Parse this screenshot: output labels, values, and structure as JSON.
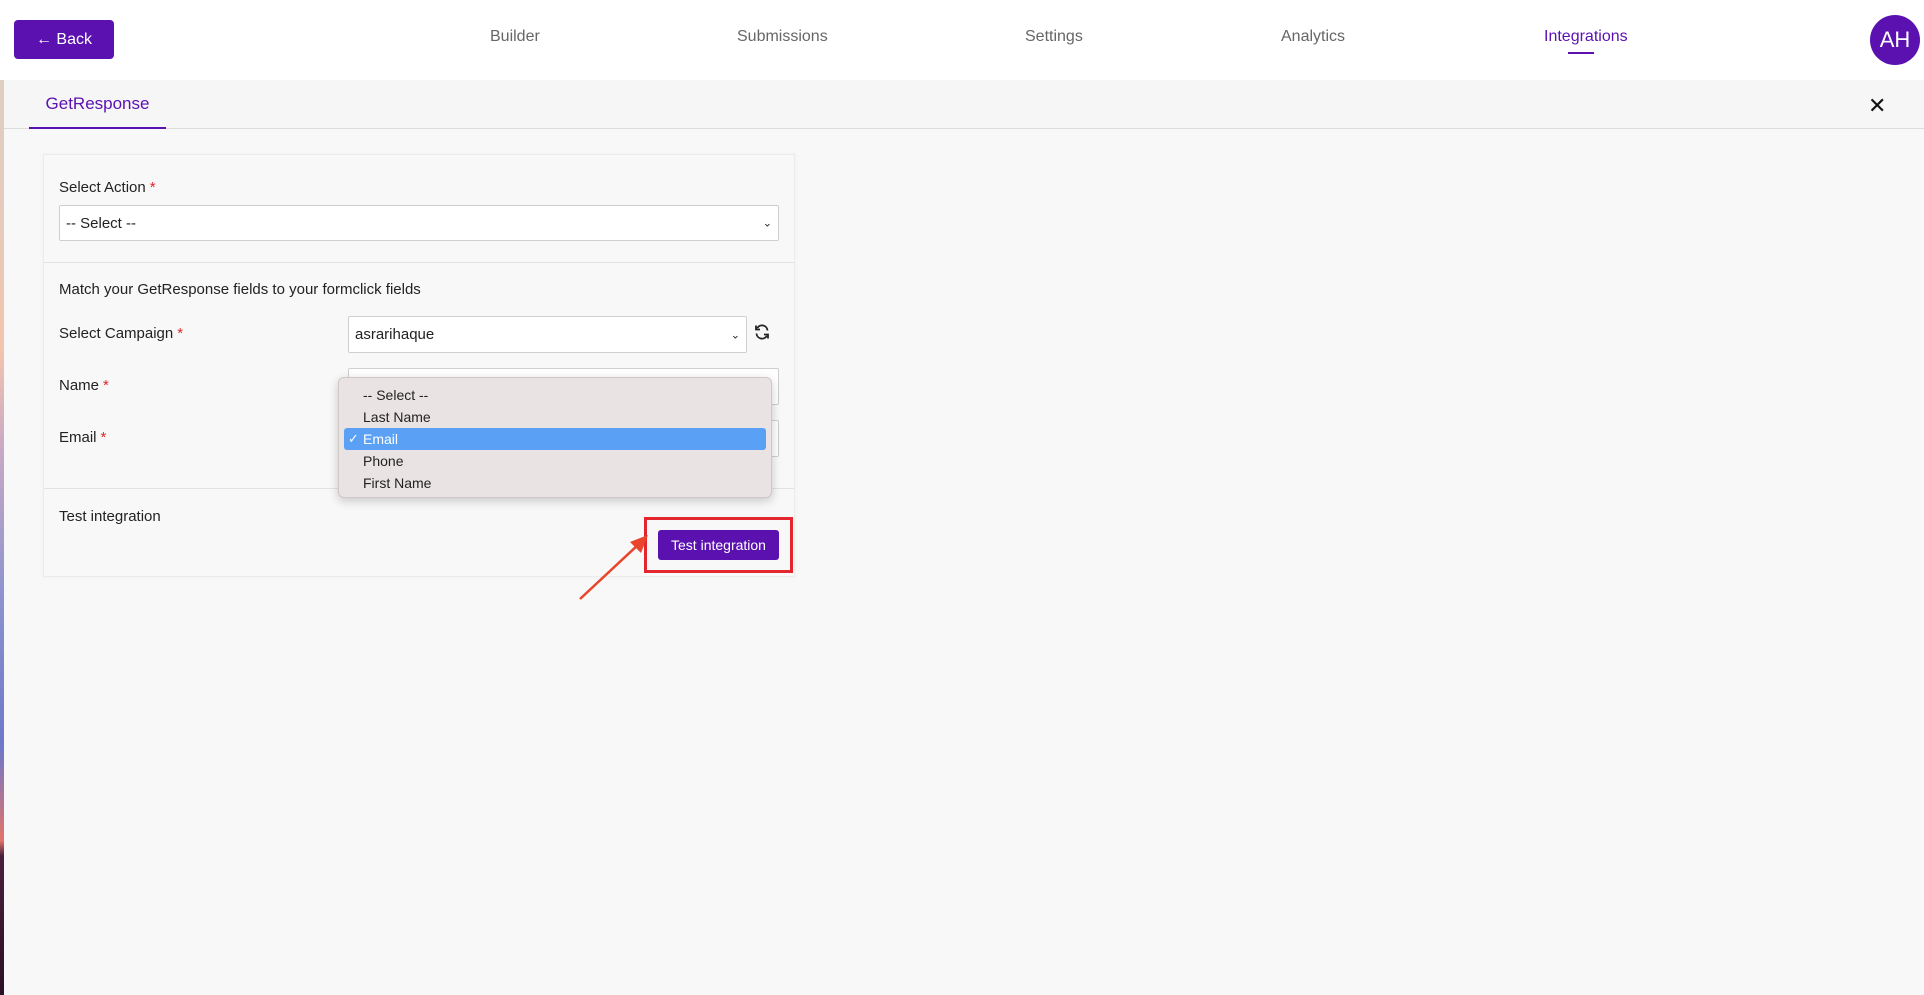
{
  "topbar": {
    "back_label": "← Back",
    "nav": [
      {
        "label": "Builder"
      },
      {
        "label": "Submissions"
      },
      {
        "label": "Settings"
      },
      {
        "label": "Analytics"
      },
      {
        "label": "Integrations",
        "active": true
      }
    ],
    "avatar_initials": "AH"
  },
  "subheader": {
    "tab_label": "GetResponse",
    "close_icon": "close-icon"
  },
  "form": {
    "action_label": "Select Action",
    "action_required": "*",
    "action_value": "-- Select --",
    "mapping_title": "Match your GetResponse fields to your formclick fields",
    "campaign_label": "Select Campaign",
    "campaign_required": "*",
    "campaign_value": "asrarihaque",
    "name_label": "Name",
    "name_required": "*",
    "email_label": "Email",
    "email_required": "*",
    "test_title": "Test integration",
    "test_button": "Test integration"
  },
  "dropdown": {
    "options": [
      {
        "label": "-- Select --"
      },
      {
        "label": "Last Name"
      },
      {
        "label": "Email",
        "selected": true
      },
      {
        "label": "Phone"
      },
      {
        "label": "First Name"
      }
    ],
    "check_glyph": "✓"
  },
  "colors": {
    "brand": "#5b11b0",
    "highlight": "#e3262d",
    "selected_option": "#5aa0f5"
  }
}
